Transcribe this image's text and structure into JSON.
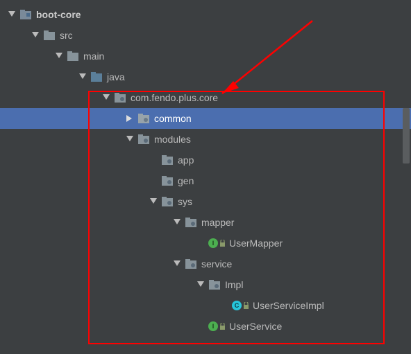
{
  "colors": {
    "bg": "#3c3f41",
    "selected": "#4b6eaf",
    "text": "#bbbbbb",
    "highlight": "#ff0000",
    "folder_module": "#7a8a99",
    "folder_dir": "#87939a",
    "folder_src": "#5b7f9a",
    "folder_pkg": "#87939a",
    "interface_badge": "#4caf50",
    "class_badge": "#26c6da"
  },
  "tree": {
    "root": {
      "label": "boot-core",
      "type": "module",
      "expanded": true
    },
    "src": {
      "label": "src",
      "type": "dir",
      "expanded": true
    },
    "main": {
      "label": "main",
      "type": "dir",
      "expanded": true
    },
    "java": {
      "label": "java",
      "type": "src-root",
      "expanded": true
    },
    "pkg_root": {
      "label": "com.fendo.plus.core",
      "type": "package",
      "expanded": true
    },
    "common": {
      "label": "common",
      "type": "package",
      "expanded": false,
      "selected": true
    },
    "modules": {
      "label": "modules",
      "type": "package",
      "expanded": true
    },
    "app": {
      "label": "app",
      "type": "package",
      "expanded": false
    },
    "gen": {
      "label": "gen",
      "type": "package",
      "expanded": false
    },
    "sys": {
      "label": "sys",
      "type": "package",
      "expanded": true
    },
    "mapper": {
      "label": "mapper",
      "type": "package",
      "expanded": true
    },
    "UserMapper": {
      "label": "UserMapper",
      "type": "interface"
    },
    "service": {
      "label": "service",
      "type": "package",
      "expanded": true
    },
    "Impl": {
      "label": "Impl",
      "type": "package",
      "expanded": true
    },
    "UserServiceImpl": {
      "label": "UserServiceImpl",
      "type": "class"
    },
    "UserService": {
      "label": "UserService",
      "type": "interface"
    }
  }
}
